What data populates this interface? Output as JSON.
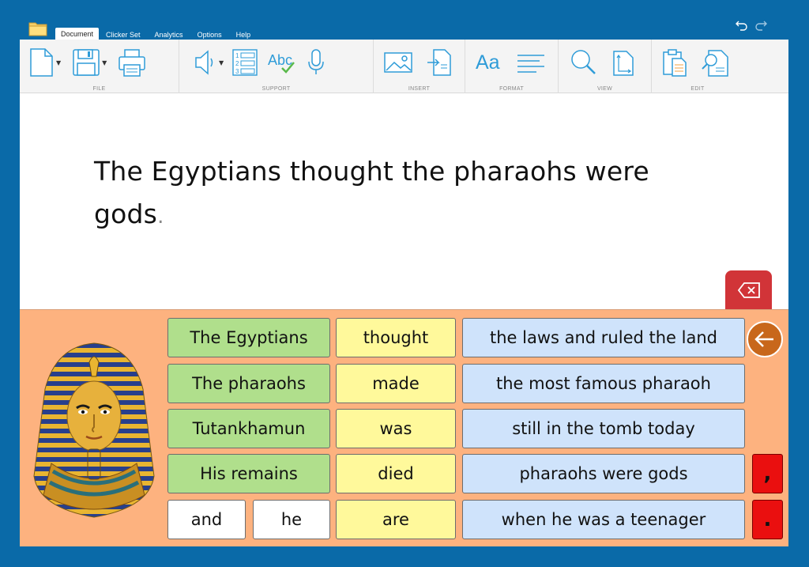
{
  "tabs": [
    "Document",
    "Clicker Set",
    "Analytics",
    "Options",
    "Help"
  ],
  "ribbon": {
    "groups": {
      "file": "FILE",
      "support": "SUPPORT",
      "insert": "INSERT",
      "format": "FORMAT",
      "view": "VIEW",
      "edit": "EDIT"
    },
    "format_text": "Aa",
    "spell_text": "Abc"
  },
  "document": {
    "text": "The Egyptians thought the pharaohs were gods",
    "punct": "."
  },
  "grid": {
    "col1": [
      "The Egyptians",
      "The pharaohs",
      "Tutankhamun",
      "His remains"
    ],
    "col1_small": [
      "and",
      "he"
    ],
    "col2": [
      "thought",
      "made",
      "was",
      "died",
      "are"
    ],
    "col3": [
      "the laws and ruled the land",
      "the most famous pharaoh",
      "still in the tomb today",
      "pharaohs were gods",
      "when he was a teenager"
    ],
    "punctuation": [
      ",",
      "."
    ]
  },
  "colors": {
    "background": "#0a6aa8",
    "grid_bg": "#fdb27f",
    "subject": "#b0df8c",
    "verb": "#fff99b",
    "object": "#cfe3fb",
    "punct": "#ea0f0f",
    "delete": "#d13438",
    "back": "#c8671b"
  },
  "icons": [
    "folder-icon",
    "undo-icon",
    "redo-icon",
    "new-document-icon",
    "save-icon",
    "print-icon",
    "speech-icon",
    "word-list-icon",
    "spell-check-icon",
    "microphone-icon",
    "insert-picture-icon",
    "insert-file-icon",
    "format-icon",
    "align-icon",
    "zoom-icon",
    "page-view-icon",
    "paste-icon",
    "find-icon",
    "delete-icon",
    "back-arrow-icon",
    "pharaoh-mask-image"
  ]
}
